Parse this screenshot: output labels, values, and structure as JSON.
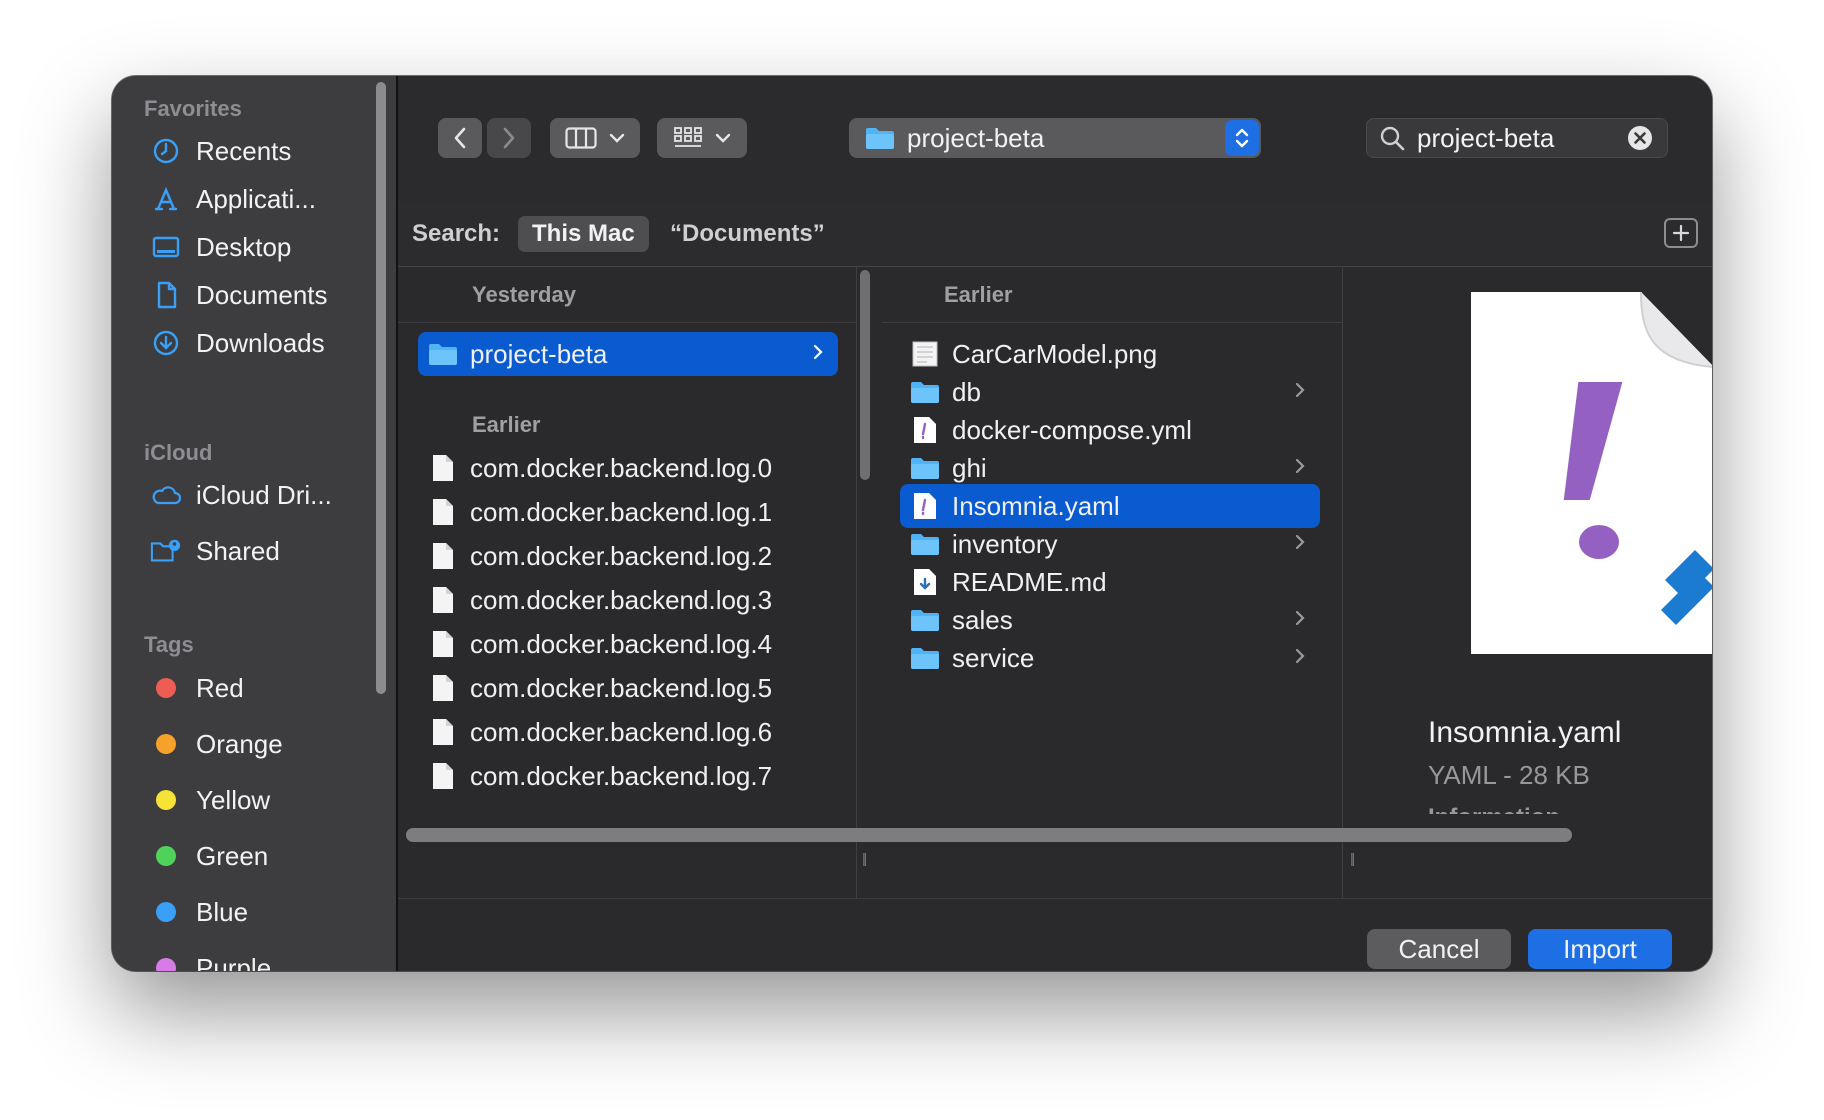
{
  "sidebar": {
    "sections": [
      {
        "title": "Favorites",
        "items": [
          {
            "label": "Recents",
            "icon": "clock-icon"
          },
          {
            "label": "Applicati...",
            "icon": "applications-icon"
          },
          {
            "label": "Desktop",
            "icon": "desktop-icon"
          },
          {
            "label": "Documents",
            "icon": "document-icon"
          },
          {
            "label": "Downloads",
            "icon": "download-icon"
          }
        ]
      },
      {
        "title": "iCloud",
        "items": [
          {
            "label": "iCloud Dri...",
            "icon": "cloud-icon"
          },
          {
            "label": "Shared",
            "icon": "shared-folder-icon"
          }
        ]
      },
      {
        "title": "Tags",
        "items": [
          {
            "label": "Red",
            "color": "#ee5d53"
          },
          {
            "label": "Orange",
            "color": "#f6a22a"
          },
          {
            "label": "Yellow",
            "color": "#f7e236"
          },
          {
            "label": "Green",
            "color": "#4fd259"
          },
          {
            "label": "Blue",
            "color": "#3a9ff6"
          },
          {
            "label": "Purple",
            "color": "#d77ce6"
          }
        ]
      }
    ]
  },
  "toolbar": {
    "path": "project-beta",
    "search_value": "project-beta"
  },
  "scope": {
    "label": "Search:",
    "selected": "This Mac",
    "other": "“Documents”"
  },
  "column1": {
    "group1": "Yesterday",
    "selected_folder": "project-beta",
    "group2": "Earlier",
    "files": [
      "com.docker.backend.log.0",
      "com.docker.backend.log.1",
      "com.docker.backend.log.2",
      "com.docker.backend.log.3",
      "com.docker.backend.log.4",
      "com.docker.backend.log.5",
      "com.docker.backend.log.6",
      "com.docker.backend.log.7"
    ]
  },
  "column2": {
    "group": "Earlier",
    "items": [
      {
        "name": "CarCarModel.png",
        "kind": "image",
        "folder": false
      },
      {
        "name": "db",
        "kind": "folder",
        "folder": true
      },
      {
        "name": "docker-compose.yml",
        "kind": "yaml",
        "folder": false
      },
      {
        "name": "ghi",
        "kind": "folder",
        "folder": true
      },
      {
        "name": "Insomnia.yaml",
        "kind": "yaml",
        "folder": false,
        "selected": true
      },
      {
        "name": "inventory",
        "kind": "folder",
        "folder": true
      },
      {
        "name": "README.md",
        "kind": "markdown",
        "folder": false
      },
      {
        "name": "sales",
        "kind": "folder",
        "folder": true
      },
      {
        "name": "service",
        "kind": "folder",
        "folder": true
      }
    ]
  },
  "preview": {
    "name": "Insomnia.yaml",
    "meta": "YAML - 28 KB",
    "info_heading": "Information"
  },
  "buttons": {
    "cancel": "Cancel",
    "import": "Import"
  },
  "colors": {
    "accent": "#0a5ad0",
    "folder": "#4fb3f5"
  }
}
